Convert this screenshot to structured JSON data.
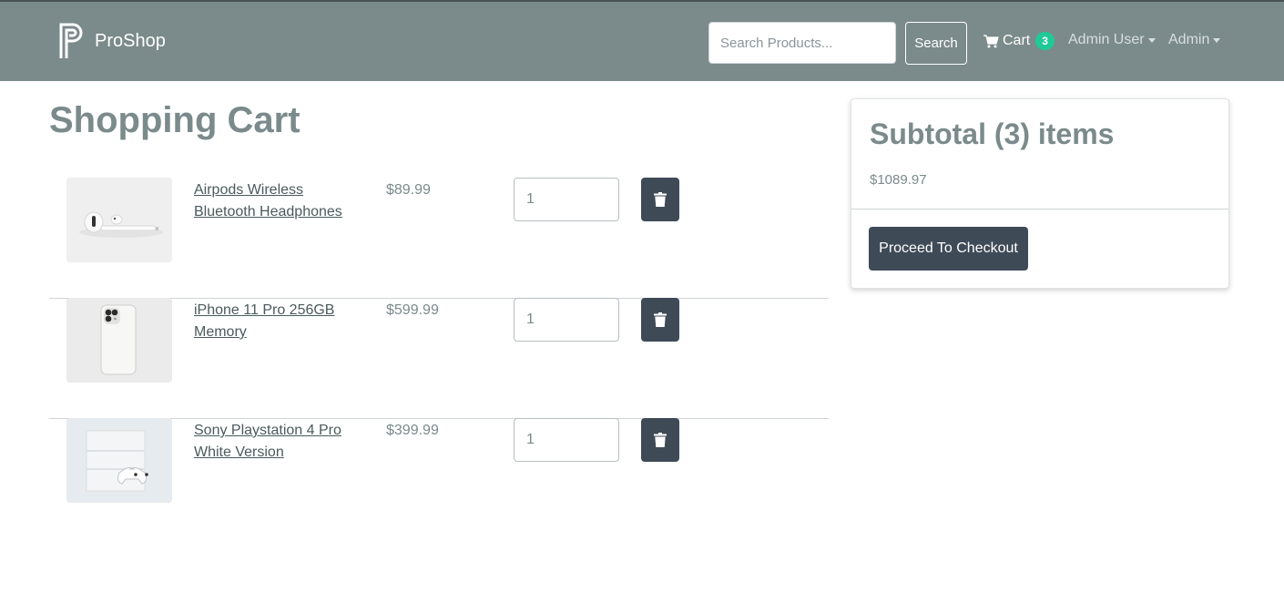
{
  "navbar": {
    "brand_name": "ProShop",
    "search_placeholder": "Search Products...",
    "search_button_label": "Search",
    "cart_label": "Cart",
    "cart_count": "3",
    "user_menu_label": "Admin User",
    "admin_menu_label": "Admin"
  },
  "page": {
    "title": "Shopping Cart"
  },
  "cart": {
    "items": [
      {
        "name": "Airpods Wireless Bluetooth Headphones",
        "price": "$89.99",
        "qty": "1",
        "image": "airpods-image"
      },
      {
        "name": "iPhone 11 Pro 256GB Memory",
        "price": "$599.99",
        "qty": "1",
        "image": "iphone-image"
      },
      {
        "name": "Sony Playstation 4 Pro White Version",
        "price": "$399.99",
        "qty": "1",
        "image": "playstation-image"
      }
    ]
  },
  "summary": {
    "title": "Subtotal (3) items",
    "total": "$1089.97",
    "checkout_label": "Proceed To Checkout"
  },
  "colors": {
    "navbar_bg": "#7b8a8b",
    "button_dark": "#3f4a57",
    "badge": "#20c997",
    "text_muted": "#7b8a8b"
  }
}
